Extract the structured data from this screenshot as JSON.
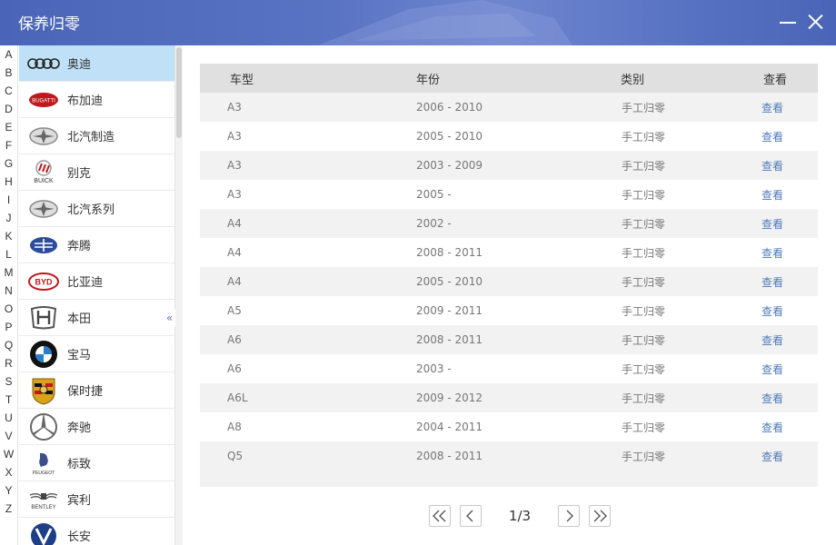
{
  "window": {
    "title": "保养归零"
  },
  "letters": [
    "A",
    "B",
    "C",
    "D",
    "E",
    "F",
    "G",
    "H",
    "I",
    "J",
    "K",
    "L",
    "M",
    "N",
    "O",
    "P",
    "Q",
    "R",
    "S",
    "T",
    "U",
    "V",
    "W",
    "X",
    "Y",
    "Z"
  ],
  "brands": [
    {
      "name": "奥迪",
      "icon": "audi-logo-icon",
      "selected": true
    },
    {
      "name": "布加迪",
      "icon": "bugatti-logo-icon",
      "logo_text": "BUGATTI"
    },
    {
      "name": "北汽制造",
      "icon": "baic-logo-icon"
    },
    {
      "name": "别克",
      "icon": "buick-logo-icon",
      "logo_text": "BUICK"
    },
    {
      "name": "北汽系列",
      "icon": "baic-series-logo-icon"
    },
    {
      "name": "奔腾",
      "icon": "besturn-logo-icon"
    },
    {
      "name": "比亚迪",
      "icon": "byd-logo-icon",
      "logo_text": "BYD"
    },
    {
      "name": "本田",
      "icon": "honda-logo-icon"
    },
    {
      "name": "宝马",
      "icon": "bmw-logo-icon"
    },
    {
      "name": "保时捷",
      "icon": "porsche-logo-icon"
    },
    {
      "name": "奔驰",
      "icon": "mercedes-logo-icon"
    },
    {
      "name": "标致",
      "icon": "peugeot-logo-icon",
      "logo_text": "PEUGEOT"
    },
    {
      "name": "宾利",
      "icon": "bentley-logo-icon",
      "logo_text": "BENTLEY"
    },
    {
      "name": "长安",
      "icon": "changan-logo-icon"
    }
  ],
  "table": {
    "headers": {
      "model": "车型",
      "year": "年份",
      "category": "类别",
      "view": "查看"
    },
    "rows": [
      {
        "model": "A3",
        "year": "2006 - 2010",
        "category": "手工归零",
        "view": "查看"
      },
      {
        "model": "A3",
        "year": "2005 - 2010",
        "category": "手工归零",
        "view": "查看"
      },
      {
        "model": "A3",
        "year": "2003 - 2009",
        "category": "手工归零",
        "view": "查看"
      },
      {
        "model": "A3",
        "year": "2005 -",
        "category": "手工归零",
        "view": "查看"
      },
      {
        "model": "A4",
        "year": "2002 -",
        "category": "手工归零",
        "view": "查看"
      },
      {
        "model": "A4",
        "year": "2008 - 2011",
        "category": "手工归零",
        "view": "查看"
      },
      {
        "model": "A4",
        "year": "2005 - 2010",
        "category": "手工归零",
        "view": "查看"
      },
      {
        "model": "A5",
        "year": "2009 - 2011",
        "category": "手工归零",
        "view": "查看"
      },
      {
        "model": "A6",
        "year": "2008 - 2011",
        "category": "手工归零",
        "view": "查看"
      },
      {
        "model": "A6",
        "year": "2003 -",
        "category": "手工归零",
        "view": "查看"
      },
      {
        "model": "A6L",
        "year": "2009 - 2012",
        "category": "手工归零",
        "view": "查看"
      },
      {
        "model": "A8",
        "year": "2004 - 2011",
        "category": "手工归零",
        "view": "查看"
      },
      {
        "model": "Q5",
        "year": "2008 - 2011",
        "category": "手工归零",
        "view": "查看"
      }
    ]
  },
  "pagination": {
    "page_info": "1/3"
  },
  "colors": {
    "titlebar": "#5a74c4",
    "selected_brand": "#bfe0f6",
    "link": "#4f7ab8",
    "header_bg": "#e0e0e0",
    "row_alt": "#f2f2f2"
  }
}
